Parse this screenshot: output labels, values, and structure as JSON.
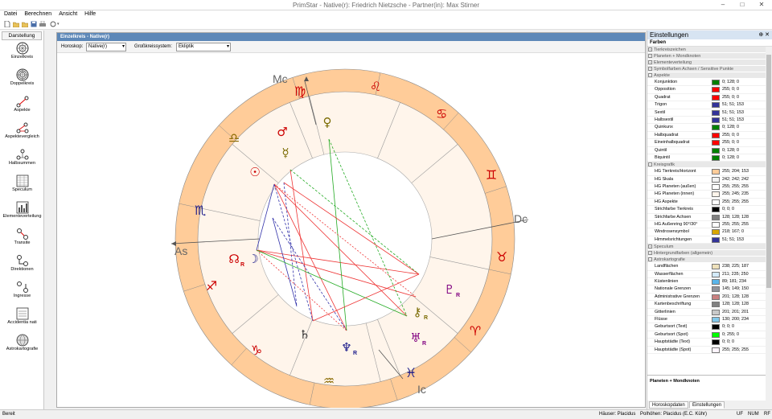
{
  "window": {
    "title": "PrimStar - Native(r): Friedrich Nietzsche - Partner(in): Max Stirner",
    "minimize": "–",
    "maximize": "□",
    "close": "✕"
  },
  "menu": [
    "Datei",
    "Berechnen",
    "Ansicht",
    "Hilfe"
  ],
  "sidebar": {
    "header": "Darstellung",
    "items": [
      {
        "label": "Einzelkreis",
        "icon": "single-circle-icon"
      },
      {
        "label": "Doppelkreis",
        "icon": "double-circle-icon"
      },
      {
        "label": "Aspekte",
        "icon": "aspects-icon"
      },
      {
        "label": "Aspektevergleich",
        "icon": "aspects-compare-icon"
      },
      {
        "label": "Halbsummen",
        "icon": "midpoints-icon"
      },
      {
        "label": "Speculum",
        "icon": "speculum-icon"
      },
      {
        "label": "Elementeverteilung",
        "icon": "elements-chart-icon"
      },
      {
        "label": "Transite",
        "icon": "transits-icon"
      },
      {
        "label": "Direktionen",
        "icon": "directions-icon"
      },
      {
        "label": "Ingresse",
        "icon": "ingresses-icon"
      },
      {
        "label": "Accidentia nati",
        "icon": "accidentia-icon"
      },
      {
        "label": "Astrokartografie",
        "icon": "astrocartography-icon"
      }
    ]
  },
  "document": {
    "tab": "Einzelkreis - Native(r)",
    "horoskop_label": "Horoskop:",
    "horoskop_value": "Native(r)",
    "grosskreis_label": "Großkreissystem:",
    "grosskreis_value": "Ekliptik"
  },
  "chart_labels": {
    "mc": "Mc",
    "ic": "Ic",
    "as": "As",
    "dc": "Dc",
    "retro": "R"
  },
  "settings": {
    "title": "Einstellungen",
    "pin": "⊕ ✕",
    "subtitle": "Farben",
    "sections": [
      {
        "name": "Tierkreiszeichen",
        "rows": []
      },
      {
        "name": "Planeten + Mondknoten",
        "rows": []
      },
      {
        "name": "Elementeverteilung",
        "rows": []
      },
      {
        "name": "Symbolfarben Achsen / Sensitive Punkte",
        "rows": []
      },
      {
        "name": "Aspekte",
        "open": true,
        "rows": [
          {
            "n": "Konjunktion",
            "c": "#008000",
            "v": "0; 128; 0"
          },
          {
            "n": "Opposition",
            "c": "#ff0000",
            "v": "255; 0; 0"
          },
          {
            "n": "Quadrat",
            "c": "#ff0000",
            "v": "255; 0; 0"
          },
          {
            "n": "Trigon",
            "c": "#333399",
            "v": "51; 51; 153"
          },
          {
            "n": "Sextil",
            "c": "#333399",
            "v": "51; 51; 153"
          },
          {
            "n": "Halbsextil",
            "c": "#333399",
            "v": "51; 51; 153"
          },
          {
            "n": "Quinkunx",
            "c": "#008000",
            "v": "0; 128; 0"
          },
          {
            "n": "Halbquadrat",
            "c": "#ff0000",
            "v": "255; 0; 0"
          },
          {
            "n": "Eineinhalbquadrat",
            "c": "#ff0000",
            "v": "255; 0; 0"
          },
          {
            "n": "Quintil",
            "c": "#008000",
            "v": "0; 128; 0"
          },
          {
            "n": "Biquintil",
            "c": "#008000",
            "v": "0; 128; 0"
          }
        ]
      },
      {
        "name": "Kreisgrafik",
        "open": true,
        "rows": [
          {
            "n": "HG Tierkreis/Horizont",
            "c": "#ffcc99",
            "v": "255; 204; 153"
          },
          {
            "n": "HG Skala",
            "c": "#f2f2f2",
            "v": "242; 242; 242"
          },
          {
            "n": "HG Planeten (außen)",
            "c": "#ffffff",
            "v": "255; 255; 255"
          },
          {
            "n": "HG Planeten (innen)",
            "c": "#fff5eb",
            "v": "255; 245; 235"
          },
          {
            "n": "HG Aspekte",
            "c": "#ffffff",
            "v": "255; 255; 255"
          },
          {
            "n": "Strichfarbe Tierkreis",
            "c": "#000000",
            "v": "0; 0; 0"
          },
          {
            "n": "Strichfarbe Achsen",
            "c": "#808080",
            "v": "128; 128; 128"
          },
          {
            "n": "HG Außenring 90°/30°",
            "c": "#ffffff",
            "v": "255; 255; 255"
          },
          {
            "n": "Windrosensymbol",
            "c": "#daa700",
            "v": "218; 167; 0"
          },
          {
            "n": "Himmelsrichtungen",
            "c": "#333399",
            "v": "51; 51; 153"
          }
        ]
      },
      {
        "name": "Speculum",
        "rows": []
      },
      {
        "name": "Hintergrundfarben (allgemein)",
        "rows": []
      },
      {
        "name": "Astrokartografie",
        "open": true,
        "rows": [
          {
            "n": "Landflächen",
            "c": "#eee1bb",
            "v": "238; 225; 187"
          },
          {
            "n": "Wasserflächen",
            "c": "#d3eafa",
            "v": "211; 235; 250"
          },
          {
            "n": "Küstenlinien",
            "c": "#59b5ea",
            "v": "89; 181; 234"
          },
          {
            "n": "Nationale Grenzen",
            "c": "#91939a",
            "v": "145; 149; 150"
          },
          {
            "n": "Administrative Grenzen",
            "c": "#c98080",
            "v": "201; 128; 128"
          },
          {
            "n": "Kartenbeschriftung",
            "c": "#808080",
            "v": "128; 128; 128"
          },
          {
            "n": "Gitterlinien",
            "c": "#c9c9c9",
            "v": "201; 201; 201"
          },
          {
            "n": "Flüsse",
            "c": "#82c8ea",
            "v": "130; 200; 234"
          },
          {
            "n": "Geburtsort (Text)",
            "c": "#000000",
            "v": "0; 0; 0"
          },
          {
            "n": "Geburtsort (Spot)",
            "c": "#00ff00",
            "v": "0; 255; 0"
          },
          {
            "n": "Hauptstädte (Text)",
            "c": "#000000",
            "v": "0; 0; 0"
          },
          {
            "n": "Hauptstädte (Spot)",
            "c": "#fff5ff",
            "v": "255; 255; 255"
          }
        ]
      }
    ],
    "footer": "Planeten + Mondknoten",
    "tabs": [
      "Horoskopdaten",
      "Einstellungen"
    ]
  },
  "status": {
    "left": "Bereit",
    "houses": "Häuser: Placidus",
    "poles": "Polhöhen: Placidus (E.C. Kühr)",
    "uf": "UF",
    "num": "NUM",
    "rf": "RF"
  }
}
